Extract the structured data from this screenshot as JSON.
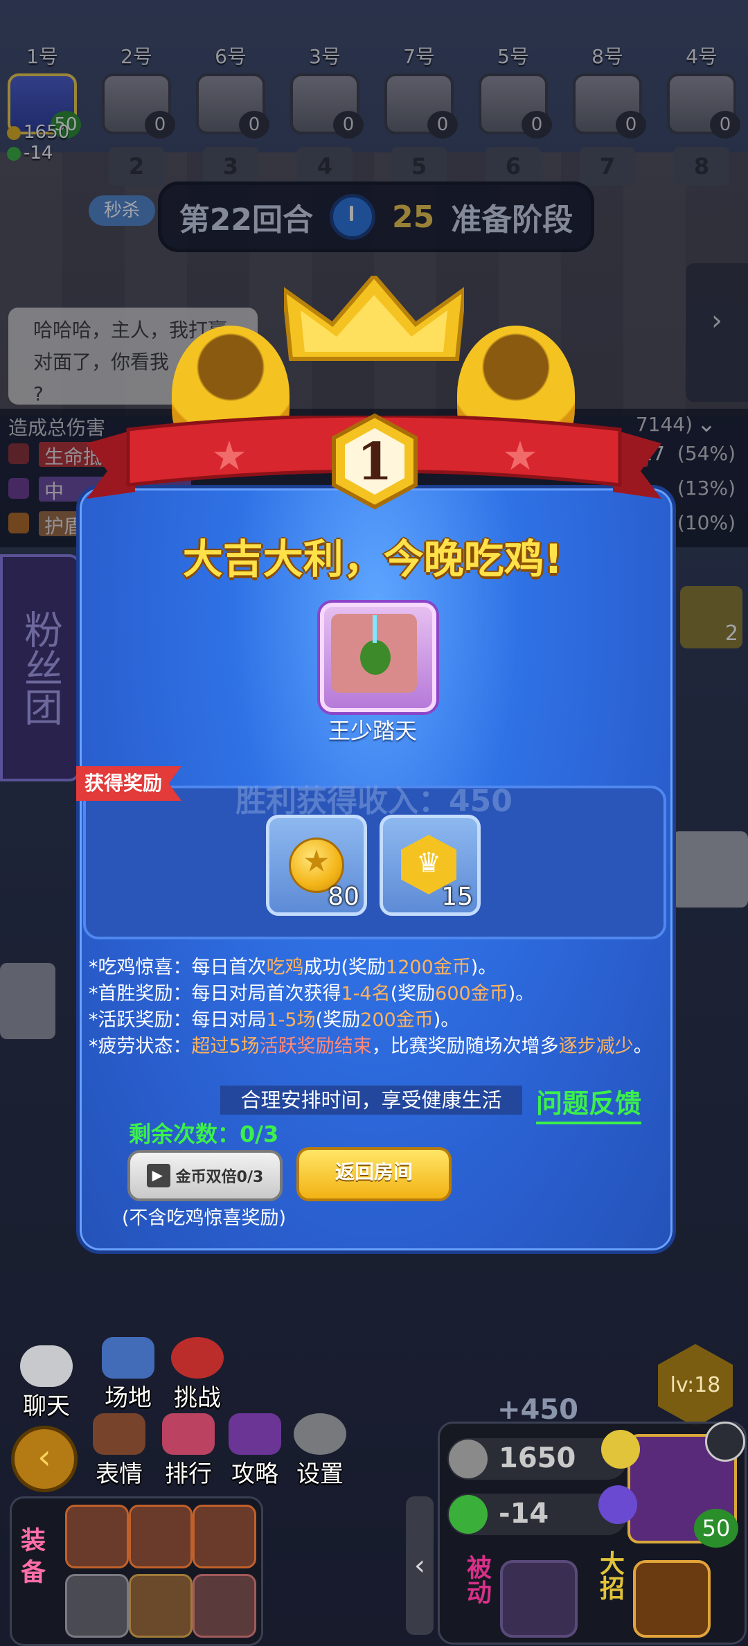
{
  "players": [
    {
      "seat": "1号",
      "lives": "50",
      "rank": ""
    },
    {
      "seat": "2号",
      "lives": "0",
      "rank": "2"
    },
    {
      "seat": "6号",
      "lives": "0",
      "rank": "3"
    },
    {
      "seat": "3号",
      "lives": "0",
      "rank": "4"
    },
    {
      "seat": "7号",
      "lives": "0",
      "rank": "5"
    },
    {
      "seat": "5号",
      "lives": "0",
      "rank": "6"
    },
    {
      "seat": "8号",
      "lives": "0",
      "rank": "7"
    },
    {
      "seat": "4号",
      "lives": "0",
      "rank": "8"
    }
  ],
  "my_stats": {
    "gold": "1650",
    "life": "-14"
  },
  "round_bar": {
    "round": "第22回合",
    "seconds": "25",
    "phase": "准备阶段"
  },
  "bg_sign": "秒杀",
  "speech": {
    "line1": "哈哈哈，主人，我打赢",
    "line2": "对面了，你看我",
    "line3": "?"
  },
  "damage_panel": {
    "title": "造成总伤害",
    "total_partial": "7144)",
    "rows": [
      {
        "label": "生命抵偿",
        "mult": "x17",
        "pct": "(54%)"
      },
      {
        "label": "中",
        "mult": "",
        "pct": "(13%)"
      },
      {
        "label": "护盾",
        "mult": "",
        "pct": "(10%)"
      }
    ]
  },
  "fan_banner": "粉丝团",
  "right_side": {
    "chevron": "›",
    "skill_count": "2"
  },
  "result": {
    "rank_number": "1",
    "title": "大吉大利，今晚吃鸡!",
    "hero_name": "王少踏天",
    "reward_tag": "获得奖励",
    "income_ghost": "胜利获得收入：450",
    "rewards": [
      {
        "icon": "gold-coin-icon",
        "count": "80"
      },
      {
        "icon": "crown-medal-icon",
        "count": "15"
      }
    ],
    "rules": {
      "r1_a": "*吃鸡惊喜：每日首次",
      "r1_b": "吃鸡",
      "r1_c": "成功(奖励",
      "r1_d": "1200金币",
      "r1_e": ")。",
      "r2_a": "*首胜奖励：每日对局首次获得",
      "r2_b": "1-4名",
      "r2_c": "(奖励",
      "r2_d": "600金币",
      "r2_e": ")。",
      "r3_a": "*活跃奖励：每日对局",
      "r3_b": "1-5场",
      "r3_c": "(奖励",
      "r3_d": "200金币",
      "r3_e": ")。",
      "r4_a": "*疲劳状态：",
      "r4_b": "超过5场",
      "r4_c": "活跃奖励结束",
      "r4_d": "，比赛奖励随场次增多",
      "r4_e": "逐步减少",
      "r4_f": "。"
    },
    "health_notice": "合理安排时间，享受健康生活",
    "feedback": "问题反馈",
    "remaining": "剩余次数：0/3",
    "double_button": "金币双倍0/3",
    "return_button": "返回房间",
    "note": "(不含吃鸡惊喜奖励)"
  },
  "hud": {
    "chat": "聊天",
    "venue": "场地",
    "challenge": "挑战",
    "emote": "表情",
    "ranking": "排行",
    "guide": "攻略",
    "settings": "设置",
    "level": "lv:18",
    "plus_income": "+450",
    "gold": "1650",
    "life": "-14",
    "hero_lives": "50",
    "passive": "被动",
    "ultimate": "大招",
    "equip": "装备",
    "collapse": "‹"
  },
  "colors": {
    "modal_blue": "#2f72e6",
    "gold": "#f4c321",
    "ribbon_red": "#d8262e",
    "green": "#3cf04a"
  }
}
